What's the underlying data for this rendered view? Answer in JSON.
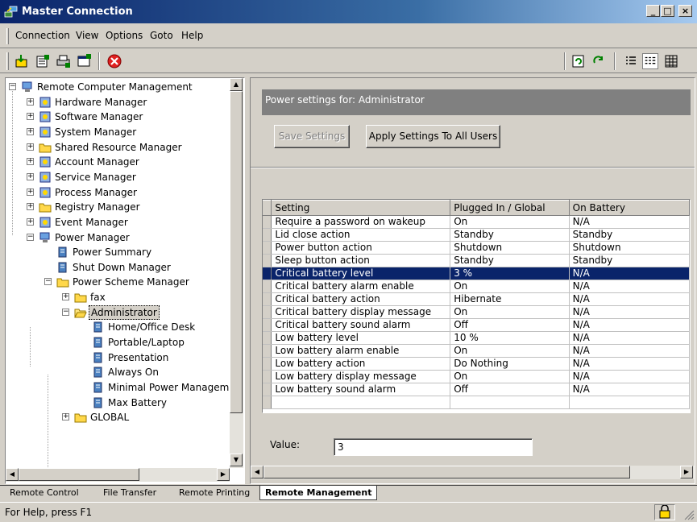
{
  "window": {
    "title": "Master Connection",
    "min_label": "_",
    "max_label": "□",
    "close_label": "×"
  },
  "menu": {
    "items": [
      {
        "label": "Connection"
      },
      {
        "label": "View"
      },
      {
        "label": "Options"
      },
      {
        "label": "Goto"
      },
      {
        "label": "Help"
      }
    ]
  },
  "tree": {
    "items": [
      {
        "label": "Remote Computer Management",
        "expander": "−"
      },
      {
        "label": "Hardware Manager",
        "expander": "+"
      },
      {
        "label": "Software Manager",
        "expander": "+"
      },
      {
        "label": "System Manager",
        "expander": "+"
      },
      {
        "label": "Shared Resource Manager",
        "expander": "+"
      },
      {
        "label": "Account Manager",
        "expander": "+"
      },
      {
        "label": "Service Manager",
        "expander": "+"
      },
      {
        "label": "Process Manager",
        "expander": "+"
      },
      {
        "label": "Registry Manager",
        "expander": "+"
      },
      {
        "label": "Event Manager",
        "expander": "+"
      },
      {
        "label": "Power Manager",
        "expander": "−"
      },
      {
        "label": "Power Summary",
        "expander": ""
      },
      {
        "label": "Shut Down Manager",
        "expander": ""
      },
      {
        "label": "Power Scheme Manager",
        "expander": "−"
      },
      {
        "label": "fax",
        "expander": "+"
      },
      {
        "label": "Administrator",
        "expander": "−"
      },
      {
        "label": "Home/Office Desk",
        "expander": ""
      },
      {
        "label": "Portable/Laptop",
        "expander": ""
      },
      {
        "label": "Presentation",
        "expander": ""
      },
      {
        "label": "Always On",
        "expander": ""
      },
      {
        "label": "Minimal Power Managem",
        "expander": ""
      },
      {
        "label": "Max Battery",
        "expander": ""
      },
      {
        "label": "GLOBAL",
        "expander": "+"
      }
    ]
  },
  "power": {
    "header": "Power settings for: Administrator",
    "save_label": "Save Settings",
    "apply_label": "Apply Settings To All Users",
    "columns": [
      "Setting",
      "Plugged In / Global",
      "On Battery"
    ],
    "rows": [
      [
        "Require a password on wakeup",
        "On",
        "N/A"
      ],
      [
        "Lid close action",
        "Standby",
        "Standby"
      ],
      [
        "Power button action",
        "Shutdown",
        "Shutdown"
      ],
      [
        "Sleep button action",
        "Standby",
        "Standby"
      ],
      [
        "Critical battery level",
        "3 %",
        "N/A"
      ],
      [
        "Critical battery alarm enable",
        "On",
        "N/A"
      ],
      [
        "Critical battery action",
        "Hibernate",
        "N/A"
      ],
      [
        "Critical battery display message",
        "On",
        "N/A"
      ],
      [
        "Critical battery sound alarm",
        "Off",
        "N/A"
      ],
      [
        "Low battery level",
        "10 %",
        "N/A"
      ],
      [
        "Low battery alarm enable",
        "On",
        "N/A"
      ],
      [
        "Low battery action",
        "Do Nothing",
        "N/A"
      ],
      [
        "Low battery display message",
        "On",
        "N/A"
      ],
      [
        "Low battery sound alarm",
        "Off",
        "N/A"
      ]
    ],
    "selected_row": 4,
    "value_label": "Value:",
    "value": "3"
  },
  "tabs": [
    {
      "label": "Remote Control"
    },
    {
      "label": "File Transfer"
    },
    {
      "label": "Remote Printing"
    },
    {
      "label": "Remote Management"
    }
  ],
  "status": {
    "text": "For Help, press F1"
  },
  "colors": {
    "title_start": "#0a246a",
    "selection": "#0a246a",
    "face": "#d4d0c8"
  }
}
